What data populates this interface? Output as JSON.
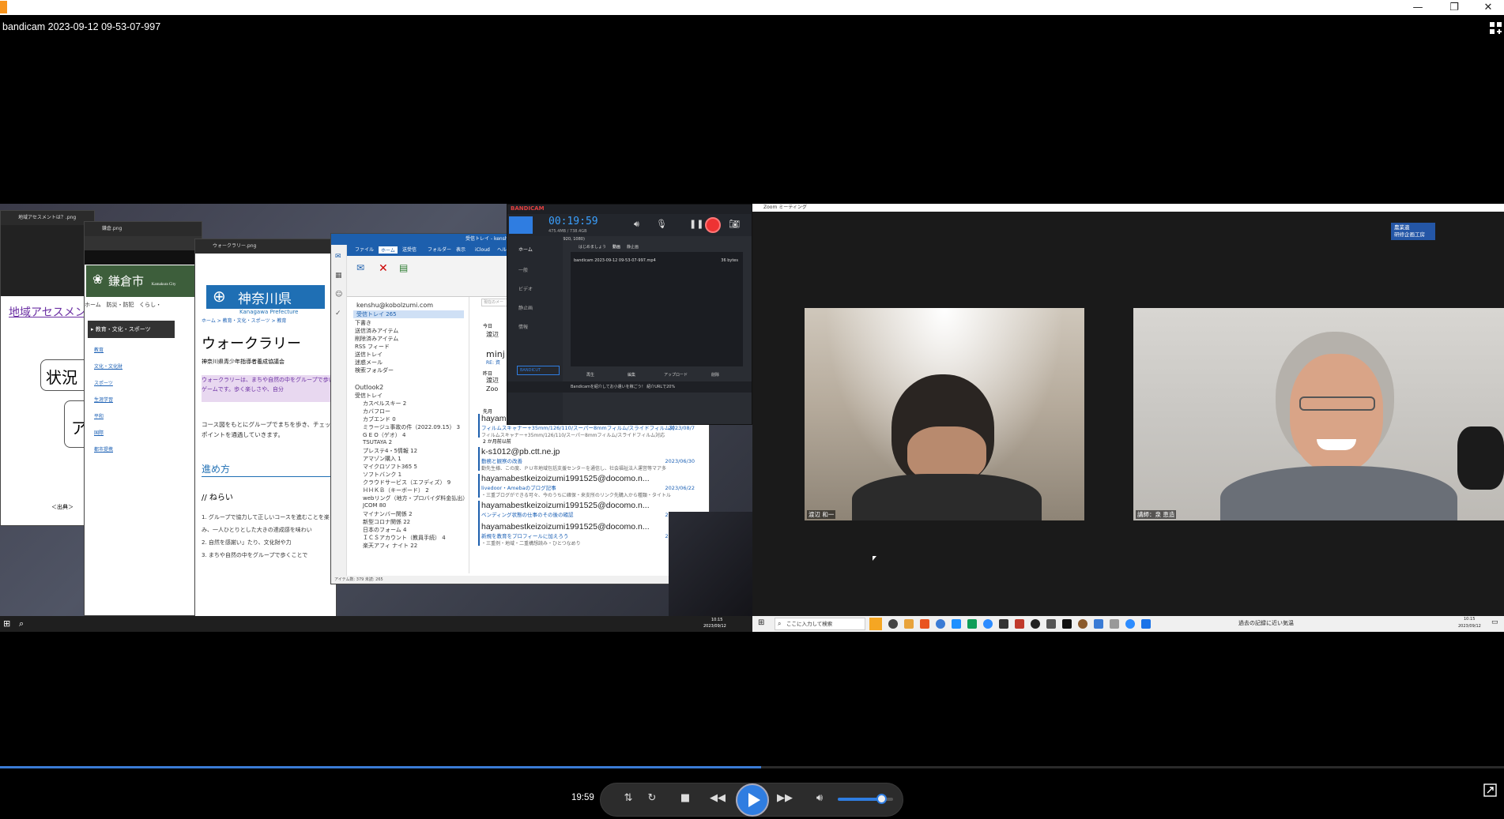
{
  "window": {
    "title": "bandicam 2023-09-12 09-53-07-997"
  },
  "left_desktop": {
    "photo1": {
      "title": "地域アセスメントは？.png",
      "link": "地域アセスメン",
      "box": "状況",
      "box2": "ア",
      "caption": "＜出典＞"
    },
    "photo2": {
      "title": "鎌倉.png",
      "city": "鎌倉市",
      "city_en": "Kamakura City",
      "nav": [
        "ホーム",
        "防災・防犯",
        "くらし・"
      ],
      "section": "▸ 教育・文化・スポーツ",
      "links": [
        "教育",
        "文化・文化財",
        "スポーツ",
        "生涯学習",
        "平和",
        "国際",
        "都市提携"
      ]
    },
    "photo3": {
      "title": "ウォークラリー.png",
      "pref": "神奈川県",
      "pref_en": "Kanagawa Prefecture",
      "breadcrumb": "ホーム > 教育・文化・スポーツ > 教育",
      "heading": "ウォークラリー",
      "sub": "神奈川県青少年指導者養成協議会",
      "highlight": "ウォークラリーは、まちや自然の中をグループで歩いてゲームです。歩く楽しさや、自分",
      "para": "コース図をもとにグループでまちを歩き、チェックポイントを通過していきます。",
      "section": "進め方",
      "sub_section": "// ねらい",
      "items": [
        "1. グループで協力して正しいコースを進むことを楽しみ、一人ひとりとした大きの達成感を味わい",
        "2. 自然を感謝い」たり、文化財や力",
        "3. まちや自然の中をグループで歩くことで"
      ]
    },
    "outlook": {
      "title": "受信トレイ - kenshu",
      "tabs": [
        "ファイル",
        "ホーム",
        "送受信",
        "フォルダー",
        "表示",
        "iCloud",
        "ヘルプ"
      ],
      "search": "現在のメー",
      "account": "kenshu@kobolzumi.com",
      "inbox": "受信トレイ 265",
      "folders": [
        "下書き",
        "送信済みアイテム",
        "削除済みアイテム",
        "RSS フィード",
        "送信トレイ",
        "迷惑メール",
        "検索フォルダー",
        "Outlook2",
        "受信トレイ",
        "カスペルスキー 2",
        "カバフロー",
        "カブエンド 0",
        "ミラージュ事故の件（2022.09.15） 3",
        "G E O（ゲオ） 4",
        "TSUTAYA 2",
        "プレステ4・5情報 12",
        "アマゾン購入 1",
        "マイクロソフト365 5",
        "ソフトバンク 1",
        "クラウドサービス（エフディズ） 9",
        "ＨＨＫＢ（キーボード） 2",
        "webリング（地方・プロバイダ料金払出）",
        "JCOM 80",
        "マイナンバー関係 2",
        "新型コロナ関係 22",
        "日本のフォーム 4",
        "ＩＣＳアカウント（教員手続） 4",
        "楽天アフィ ナイト 22"
      ],
      "headers": {
        "today": "今日",
        "yesterday": "昨日",
        "last_month": "先月",
        "two_months": "2 か月前以前"
      },
      "mails": [
        {
          "from": "hayamabestkeizoizumi1991525@docomo.n...",
          "subject": "フィルムスキャナー+35mm/126/110/スーパー8mmフィルム/スライドフィルム対...",
          "date": "2023/08/7",
          "preview": "フィルムスキャナー+35mm/126/110/スーパー8mmフィルム/スライドフィルム対応"
        },
        {
          "from": "k-s1012@pb.ctt.ne.jp",
          "subject": "勤務と観察の改善",
          "date": "2023/06/30",
          "preview": "勤先生様、この度、ＰＵ市地域包括支援センターを通信し、社会福祉法人運営等マア多"
        },
        {
          "from": "hayamabestkeizoizumi1991525@docomo.n...",
          "subject": "livedoor・Amebaのブログ記事",
          "date": "2023/06/22",
          "preview": "・三重ブログができる可々、今のうちに確保・来支所のリンク先購入から種類・タイトル"
        },
        {
          "from": "hayamabestkeizoizumi1991525@docomo.n...",
          "subject": "ベンディング状態の仕事のその後の確認",
          "date": "2023/06/21",
          "preview": ""
        },
        {
          "from": "hayamabestkeizoizumi1991525@docomo.n...",
          "subject": "新規を教育をプロフィールに加えろう",
          "date": "2023/05/28",
          "preview": "・三重例・地域・二重構想読み・ひとつなめり"
        }
      ],
      "peek": [
        "渡辺",
        "minj",
        "RE: 資",
        "渡辺",
        "Zoo"
      ],
      "status": "アイテム数: 379 未読: 265"
    },
    "bandicam": {
      "brand": "BANDICAM",
      "timer": "00:19:59",
      "size": "475.4MB / 738.4GB",
      "region": "3840x1080 - (-1920, 0), (1920, 1080)",
      "side": [
        "ホーム",
        "一般",
        "ビデオ",
        "静止画",
        "情報"
      ],
      "tabs": [
        "はじめましょう",
        "動画",
        "静止画"
      ],
      "path": "C:\\Users\\Owner\\Desktop\\デスクトップ\\bandicam\\録画保存先",
      "file": "bandicam 2023-09-12 09-53-07-997.mp4",
      "file_size": "36 bytes",
      "buttons": [
        "再生",
        "編集",
        "アップロード",
        "削除"
      ],
      "cut": "BANDICUT",
      "promo": "Bandicamを紹介してお小遣いを稼ごう！ 紹介URLで20%",
      "promo_accent": "紹介URLで20%"
    },
    "taskbar_time": "10:15",
    "taskbar_date": "2023/09/12"
  },
  "zoom": {
    "title": "Zoom ミーティング",
    "badge": "農業遺\n研修企画工房",
    "participants": [
      {
        "name": "渡辺 和一"
      },
      {
        "name": "講師：泉 恵造"
      }
    ],
    "search_placeholder": "ここに入力して検索",
    "weather": "過去の記録に近い気温",
    "time": "10:15",
    "date": "2023/09/12"
  },
  "player": {
    "time": "19:59",
    "progress": 0.506,
    "volume": 0.78,
    "accent": "#2f7de1"
  }
}
